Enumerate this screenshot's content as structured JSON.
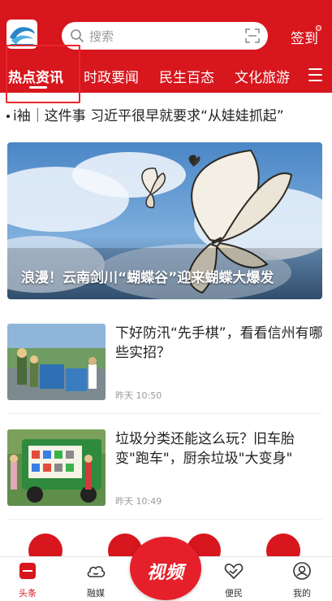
{
  "header": {
    "search_placeholder": "搜索",
    "checkin_label": "签到"
  },
  "tabs": [
    {
      "label": "热点资讯",
      "active": true
    },
    {
      "label": "时政要闻",
      "active": false
    },
    {
      "label": "民生百态",
      "active": false
    },
    {
      "label": "文化旅游",
      "active": false
    }
  ],
  "ticker": {
    "text": "i袖｜这件事 习近平很早就要求“从娃娃抓起”"
  },
  "banner": {
    "title": "浪漫！云南剑川“蝴蝶谷”迎来蝴蝶大爆发",
    "slide_count": 2,
    "active_slide": 1
  },
  "news": [
    {
      "title": "下好防汛“先手棋”，看看信州有哪些实招？",
      "time": "昨天 10:50"
    },
    {
      "title": "垃圾分类还能这么玩？旧车胎变\"跑车\"，厨余垃圾\"大变身\"",
      "time": "昨天 10:49"
    }
  ],
  "bottom_nav": [
    {
      "label": "头条",
      "icon": "headline-icon",
      "active": true
    },
    {
      "label": "融媒",
      "icon": "cloud-icon",
      "active": false
    },
    {
      "label": "视频",
      "icon": "video-icon",
      "active": false
    },
    {
      "label": "便民",
      "icon": "heart-hand-icon",
      "active": false
    },
    {
      "label": "我的",
      "icon": "user-icon",
      "active": false
    }
  ],
  "colors": {
    "brand_red": "#d7161d",
    "text_dark": "#222222",
    "text_muted": "#9a9a9a"
  }
}
